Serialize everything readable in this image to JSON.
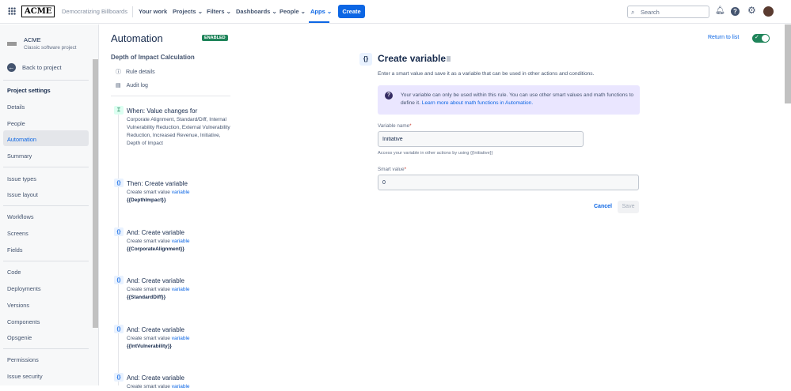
{
  "topbar": {
    "logo": "ACME",
    "project": "Democratizing Billboards",
    "nav": [
      "Your work",
      "Projects",
      "Filters",
      "Dashboards",
      "People",
      "Apps"
    ],
    "create": "Create",
    "search_placeholder": "Search"
  },
  "sidebar": {
    "project_name": "ACME",
    "project_type": "Classic software project",
    "back": "Back to project",
    "section": "Project settings",
    "items": [
      "Details",
      "People",
      "Automation",
      "Summary",
      "Issue types",
      "Issue layout",
      "Workflows",
      "Screens",
      "Fields",
      "Code",
      "Deployments",
      "Versions",
      "Components",
      "Opsgenie",
      "Permissions",
      "Issue security"
    ]
  },
  "rule": {
    "heading": "Automation",
    "status": "ENABLED",
    "name": "Depth of Impact Calculation",
    "rule_details": "Rule details",
    "audit_log": "Audit log",
    "trigger": {
      "title": "When: Value changes for",
      "desc": "Corporate Alignment, Standard/Diff, Internal Vulnerability Reduction, External Vulnerability Reduction, Increased Revenue, Initiative, Depth of Impact"
    },
    "steps": [
      {
        "title": "Then: Create variable",
        "desc": "Create smart value",
        "link": "variable",
        "var": "{{DepthImpact}}"
      },
      {
        "title": "And: Create variable",
        "desc": "Create smart value",
        "link": "variable",
        "var": "{{CorporateAlignment}}"
      },
      {
        "title": "And: Create variable",
        "desc": "Create smart value",
        "link": "variable",
        "var": "{{StandardDiff}}"
      },
      {
        "title": "And: Create variable",
        "desc": "Create smart value",
        "link": "variable",
        "var": "{{IntVulnerability}}"
      },
      {
        "title": "And: Create variable",
        "desc": "Create smart value",
        "link": "variable",
        "var": ""
      }
    ]
  },
  "panel": {
    "return": "Return to list",
    "title": "Create variable",
    "subtitle": "Enter a smart value and save it as a variable that can be used in other actions and conditions.",
    "info": "Your variable can only be used within this rule. You can use other smart values and math functions to define it.",
    "info_link": "Learn more about math functions in Automation.",
    "var_label": "Variable name",
    "var_value": "Initiative",
    "var_help": "Access your variable in other actions by using {{Initiative}}",
    "smart_label": "Smart value",
    "smart_value": "0",
    "cancel": "Cancel",
    "save": "Save",
    "required": "*"
  }
}
